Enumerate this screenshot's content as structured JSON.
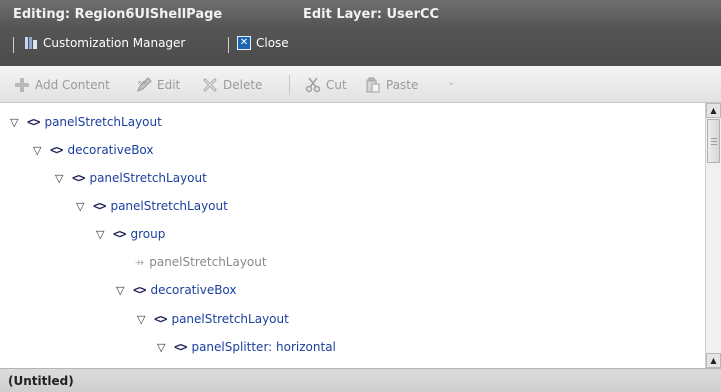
{
  "header": {
    "editing_label": "Editing: Region6UIShellPage",
    "edit_layer_label": "Edit Layer: UserCC"
  },
  "customization_bar": {
    "manager_label": "Customization Manager",
    "close_label": "Close"
  },
  "toolbar": {
    "add_content": "Add Content",
    "edit": "Edit",
    "delete": "Delete",
    "cut": "Cut",
    "paste": "Paste"
  },
  "tree": {
    "nodes": [
      {
        "label": "panelStretchLayout",
        "icon": "component-tag-icon",
        "expanded": true
      },
      {
        "label": "decorativeBox",
        "icon": "component-tag-icon",
        "expanded": true
      },
      {
        "label": "panelStretchLayout",
        "icon": "component-tag-icon",
        "expanded": true
      },
      {
        "label": "panelStretchLayout",
        "icon": "component-tag-icon",
        "expanded": true
      },
      {
        "label": "group",
        "icon": "component-tag-icon",
        "expanded": true
      },
      {
        "label": "panelStretchLayout",
        "icon": "hidden-component-icon",
        "expanded": false
      },
      {
        "label": "decorativeBox",
        "icon": "component-tag-icon",
        "expanded": true
      },
      {
        "label": "panelStretchLayout",
        "icon": "component-tag-icon",
        "expanded": true
      },
      {
        "label": "panelSplitter: horizontal",
        "icon": "component-tag-icon",
        "expanded": true
      }
    ]
  },
  "footer": {
    "status": "(Untitled)"
  },
  "colors": {
    "header_bg": "#555555",
    "node_text": "#1b3f9e",
    "disabled_text": "#8a8a8a",
    "toolbar_disabled": "#9a9a9a"
  }
}
